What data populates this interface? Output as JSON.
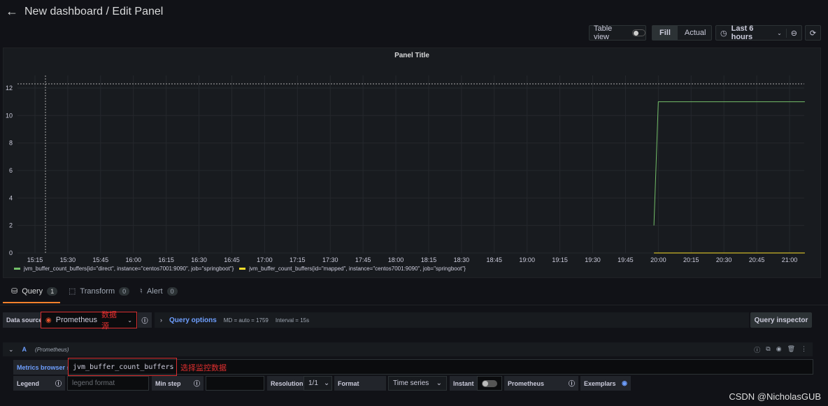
{
  "header": {
    "title": "New dashboard / Edit Panel",
    "back_icon": "arrow-left-icon"
  },
  "toolbar": {
    "table_view": "Table view",
    "table_view_on": false,
    "fill": "Fill",
    "actual": "Actual",
    "time_range": "Last 6 hours"
  },
  "panel": {
    "title": "Panel Title"
  },
  "chart_data": {
    "type": "line",
    "y_ticks": [
      0,
      2,
      4,
      6,
      8,
      10,
      12
    ],
    "x_ticks": [
      "15:15",
      "15:30",
      "15:45",
      "16:00",
      "16:15",
      "16:30",
      "16:45",
      "17:00",
      "17:15",
      "17:30",
      "17:45",
      "18:00",
      "18:15",
      "18:30",
      "18:45",
      "19:00",
      "19:15",
      "19:30",
      "19:45",
      "20:00",
      "20:15",
      "20:30",
      "20:45",
      "21:00"
    ],
    "grid": true,
    "legend_position": "bottom",
    "series": [
      {
        "name": "jvm_buffer_count_buffers{id=\"direct\", instance=\"centos7001:9090\", job=\"springboot\"}",
        "color": "#73bf69",
        "points": [
          [
            "19:58",
            2
          ],
          [
            "20:00",
            11
          ],
          [
            "21:07",
            11
          ]
        ]
      },
      {
        "name": "jvm_buffer_count_buffers{id=\"mapped\", instance=\"centos7001:9090\", job=\"springboot\"}",
        "color": "#fade2a",
        "points": [
          [
            "19:58",
            0
          ],
          [
            "21:07",
            0
          ]
        ]
      }
    ]
  },
  "tabs": [
    {
      "label": "Query",
      "count": "1"
    },
    {
      "label": "Transform",
      "count": "0"
    },
    {
      "label": "Alert",
      "count": "0"
    }
  ],
  "query": {
    "data_source_label": "Data source",
    "data_source": "Prometheus",
    "ds_annotation": "数据源",
    "query_options": "Query options",
    "md": "MD = auto = 1759",
    "interval": "Interval = 15s",
    "inspector": "Query inspector",
    "ref": "A",
    "ref_ds": "(Prometheus)",
    "metrics_browser": "Metrics browser ›",
    "expr": "jvm_buffer_count_buffers",
    "expr_annotation": "选择监控数据",
    "legend": "Legend",
    "legend_placeholder": "legend format",
    "min_step": "Min step",
    "resolution": "Resolution",
    "resolution_value": "1/1",
    "format": "Format",
    "format_value": "Time series",
    "instant": "Instant",
    "type": "Prometheus",
    "exemplars": "Exemplars"
  },
  "watermark": "CSDN @NicholasGUB"
}
